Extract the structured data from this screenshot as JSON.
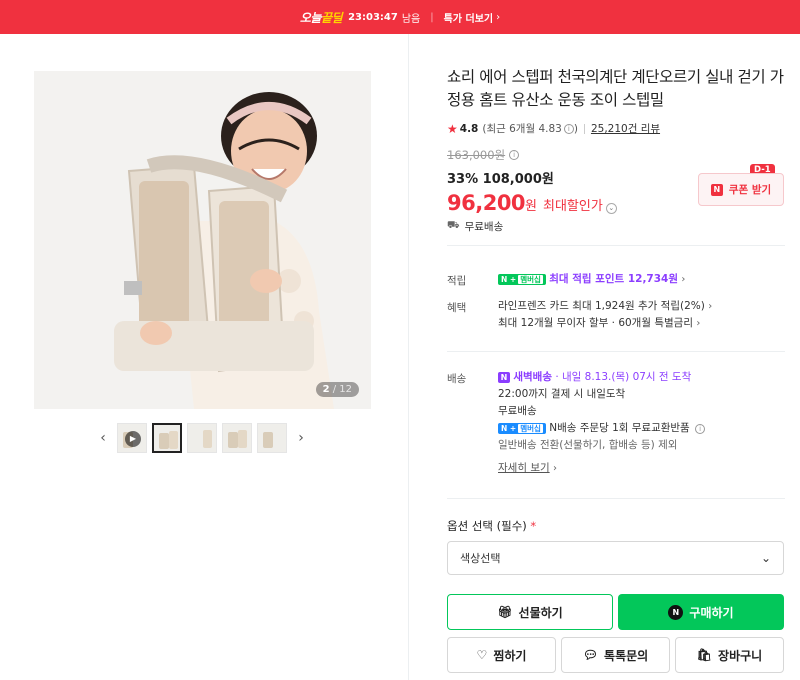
{
  "banner": {
    "logo_main": "오늘",
    "logo_accent": "끝딜",
    "timer": "23:03:47",
    "timer_suffix": "남음",
    "cta": "특가 더보기"
  },
  "gallery": {
    "counter_current": "2",
    "counter_total": "12"
  },
  "product": {
    "title": "쇼리 에어 스텝퍼 천국의계단 계단오르기 실내 걷기 가정용 홈트 유산소 운동 조이 스텝밀",
    "rating": "4.8",
    "rating_recent": "(최근 6개월 4.83",
    "rating_recent_close": ")",
    "reviews": "25,210건 리뷰",
    "original_price": "163,000원",
    "discount_rate": "33%",
    "sale_price": "108,000원",
    "final_price": "96,200",
    "final_unit": "원",
    "final_label": "최대할인가"
  },
  "coupon": {
    "badge": "D-1",
    "label": "쿠폰 받기",
    "icon_text": "N"
  },
  "shipping_free": "무료배송",
  "benefits": {
    "points_label": "적립",
    "points_text": "최대 적립 포인트 12,734원",
    "benefit_label": "혜택",
    "benefit_line1": "라인프렌즈 카드 최대 1,924원 추가 적립(2%)",
    "benefit_line2": "최대 12개월 무이자 할부 · 60개월 특별금리"
  },
  "delivery": {
    "label": "배송",
    "dawn_label": "새벽배송",
    "dawn_date": "· 내일 8.13.(목) 07시 전 도착",
    "line2": "22:00까지 결제 시 내일도착",
    "line3": "무료배송",
    "line4": "N배송 주문당 1회 무료교환반품",
    "line5": "일반배송 전환(선물하기, 합배송 등) 제외",
    "more": "자세히 보기"
  },
  "membership_badge": {
    "n": "N",
    "plus": "+",
    "member": "멤버십"
  },
  "options": {
    "label": "옵션 선택 (필수)",
    "required_mark": "*",
    "select_value": "색상선택"
  },
  "actions": {
    "gift": "선물하기",
    "buy": "구매하기",
    "wish": "찜하기",
    "talk": "톡톡문의",
    "cart": "장바구니"
  },
  "colors": {
    "brand_red": "#f0313f",
    "naver_green": "#03c75a",
    "dawn_purple": "#8b3dff"
  }
}
